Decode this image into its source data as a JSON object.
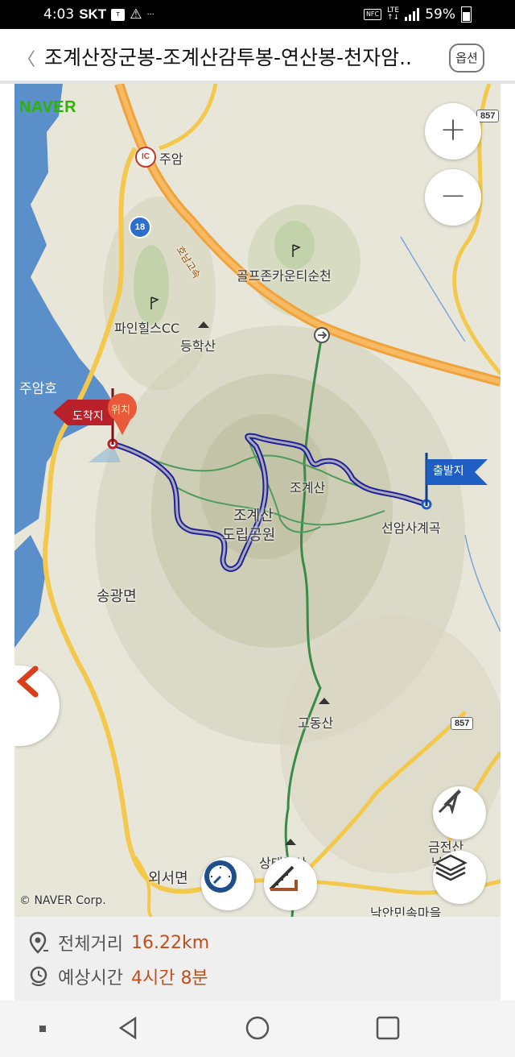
{
  "status_bar": {
    "time": "4:03",
    "carrier": "SKT",
    "battery": "59%",
    "ellipsis": "···"
  },
  "header": {
    "back_icon": "chevron-left-icon",
    "title": "조계산장군봉-조계산감투봉-연산봉-천자암..",
    "options_label": "옵션"
  },
  "map": {
    "brand": "NAVER",
    "copyright": "© NAVER Corp.",
    "labels": {
      "juam": "주암",
      "golf1": "골프존카운티순천",
      "golf2": "파인힐스CC",
      "deunghaksan": "등학산",
      "juamho": "주암호",
      "jogyesan": "조계산",
      "park_line1": "조계산",
      "park_line2": "도립공원",
      "seonamsa": "선암사계곡",
      "songgwang": "송광면",
      "godongsan": "고동산",
      "oeseo": "외서면",
      "bottom_mtn": "상태봉산",
      "geumjeon": "금전산",
      "nagan": "낙안면",
      "naganvillage": "낙안민속마을",
      "highway": "호남고속"
    },
    "road_signs": {
      "ic": "IC",
      "route18": "18",
      "route857_top": "857",
      "route857_bottom": "857"
    },
    "markers": {
      "end_flag": "도착지",
      "location_pin": "위치",
      "start_flag": "출발지"
    },
    "zoom_in": "+",
    "zoom_out": "−",
    "colors": {
      "route": "#2c2ca8",
      "trail": "#3a8a4a",
      "water": "#5b8fc9",
      "end_flag": "#b8202a",
      "start_flag": "#1f5fc4",
      "accent": "#c0501a"
    }
  },
  "summary": {
    "distance_label": "전체거리",
    "distance_value": "16.22km",
    "time_label": "예상시간",
    "time_value": "4시간 8분"
  }
}
